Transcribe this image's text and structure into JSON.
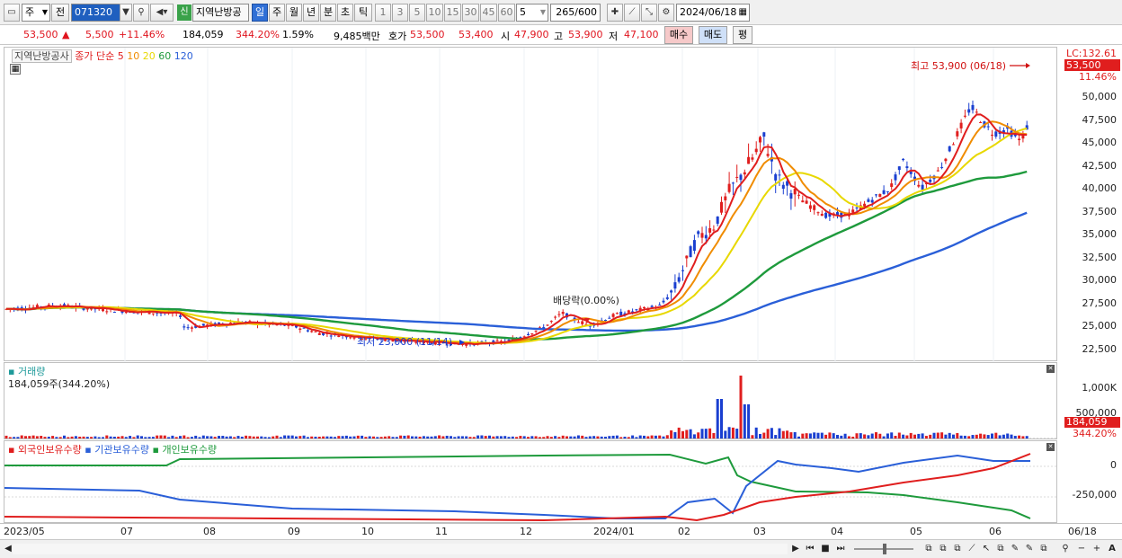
{
  "toolbar": {
    "type_select": "주",
    "prev_label": "전",
    "code": "071320",
    "stock_name": "지역난방공",
    "new_badge": "신",
    "periods": [
      "일",
      "주",
      "월",
      "년",
      "분",
      "초",
      "틱"
    ],
    "minutes": [
      "1",
      "3",
      "5",
      "10",
      "15",
      "30",
      "45",
      "60"
    ],
    "interval_value": "5",
    "count": "265",
    "count_total": "/600",
    "date": "2024/06/18"
  },
  "quote": {
    "price": "53,500",
    "change_arrow": "▲",
    "change": "5,500",
    "change_pct": "+11.46%",
    "volume": "184,059",
    "volume_ratio": "344.20%",
    "turnover": "1.59%",
    "amount": "9,485백만",
    "hoga_label": "호가",
    "ask": "53,500",
    "bid": "53,400",
    "open_label": "시",
    "open": "47,900",
    "high_label": "고",
    "high": "53,900",
    "low_label": "저",
    "low": "47,100",
    "buy_label": "매수",
    "sell_label": "매도",
    "eval_label": "평"
  },
  "price_pane": {
    "name": "지역난방공사",
    "series_label": "종가 단순",
    "ma": [
      {
        "period": "5",
        "color": "#e01e1e"
      },
      {
        "period": "10",
        "color": "#f08c00"
      },
      {
        "period": "20",
        "color": "#e8d800"
      },
      {
        "period": "60",
        "color": "#1e9a3c"
      },
      {
        "period": "120",
        "color": "#2a5fd8"
      }
    ],
    "lc_label": "LC:132.61",
    "current_tag": "53,500",
    "current_pct_tag": "11.46%",
    "y_ticks": [
      "50,000",
      "47,500",
      "45,000",
      "42,500",
      "40,000",
      "37,500",
      "35,000",
      "32,500",
      "30,000",
      "27,500",
      "25,000",
      "22,500"
    ],
    "annotation_high": "최고 53,900 (06/18)",
    "annotation_low": "최저 23,000 (11/14)",
    "annotation_div": "배당락(0.00%)"
  },
  "volume_pane": {
    "title": "거래량",
    "value_label": "184,059주(344.20%)",
    "y_ticks": [
      "1,000K",
      "500,000"
    ],
    "current_tag": "184,059",
    "current_pct_tag": "344.20%"
  },
  "holding_pane": {
    "legend": [
      {
        "label": "외국인보유수량",
        "color": "#e01e1e"
      },
      {
        "label": "기관보유수량",
        "color": "#2a5fd8"
      },
      {
        "label": "개인보유수량",
        "color": "#1e9a3c"
      }
    ],
    "y_ticks": [
      "0",
      "-250,000"
    ]
  },
  "x_axis": {
    "labels": [
      "2023/05",
      "07",
      "08",
      "09",
      "10",
      "11",
      "12",
      "2024/01",
      "02",
      "03",
      "04",
      "05",
      "06"
    ],
    "end_label": "06/18"
  },
  "colors": {
    "up": "#e01e1e",
    "down": "#1a3fd0",
    "accent": "#2f6fd6"
  }
}
